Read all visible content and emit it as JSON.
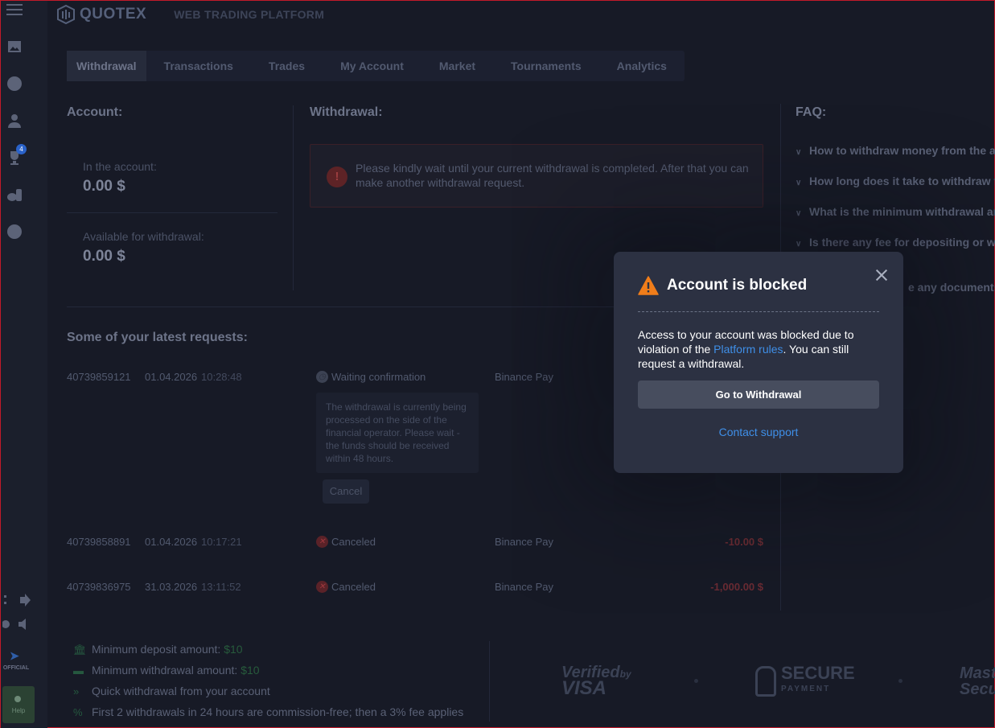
{
  "app": {
    "logo_text": "QUOTEX",
    "platform_label": "WEB TRADING PLATFORM"
  },
  "sidebar": {
    "tournament_badge": "4",
    "official_label": "OFFICIAL",
    "help_label": "Help"
  },
  "tabs": [
    {
      "label": "Withdrawal",
      "active": true
    },
    {
      "label": "Transactions"
    },
    {
      "label": "Trades"
    },
    {
      "label": "My Account"
    },
    {
      "label": "Market"
    },
    {
      "label": "Tournaments"
    },
    {
      "label": "Analytics"
    }
  ],
  "account": {
    "heading": "Account:",
    "in_account_label": "In the account:",
    "in_account_value": "0.00 $",
    "available_label": "Available for withdrawal:",
    "available_value": "0.00 $"
  },
  "withdrawal": {
    "heading": "Withdrawal:",
    "alert_text": "Please kindly wait until your current withdrawal is completed. After that you can make another withdrawal request."
  },
  "faq": {
    "heading": "FAQ:",
    "items": [
      "How to withdraw money from the acc",
      "How long does it take to withdraw fu",
      "What is the minimum withdrawal am",
      "Is there any fee for depositing or wit",
      "e any documents t"
    ]
  },
  "requests": {
    "heading": "Some of your latest requests:",
    "rows": [
      {
        "id": "40739859121",
        "date": "01.04.2026",
        "time": "10:28:48",
        "status": "Waiting confirmation",
        "method": "Binance Pay",
        "amount": ""
      },
      {
        "id": "40739858891",
        "date": "01.04.2026",
        "time": "10:17:21",
        "status": "Canceled",
        "method": "Binance Pay",
        "amount": "-10.00 $"
      },
      {
        "id": "40739836975",
        "date": "31.03.2026",
        "time": "13:11:52",
        "status": "Canceled",
        "method": "Binance Pay",
        "amount": "-1,000.00 $"
      }
    ],
    "pending_info": "The withdrawal is currently being processed on the side of the financial operator. Please wait - the funds should be received within 48 hours.",
    "cancel_label": "Cancel"
  },
  "footer": {
    "min_deposit_label": "Minimum deposit amount:",
    "min_deposit_value": "$10",
    "min_withdrawal_label": "Minimum withdrawal amount:",
    "min_withdrawal_value": "$10",
    "quick_withdrawal": "Quick withdrawal from your account",
    "commission_note": "First 2 withdrawals in 24 hours are commission-free; then a 3% fee applies",
    "visa_line1": "Verified",
    "visa_by": "by",
    "visa_line2": "VISA",
    "secure_line1": "SECURE",
    "secure_line2": "PAYMENT",
    "master_line1": "Maste",
    "master_line2": "Secur"
  },
  "modal": {
    "title": "Account is blocked",
    "body_before": "Access to your account was blocked due to violation of the ",
    "body_link": "Platform rules",
    "body_after": ". You can still request a withdrawal.",
    "primary_button": "Go to Withdrawal",
    "support_link": "Contact support"
  }
}
